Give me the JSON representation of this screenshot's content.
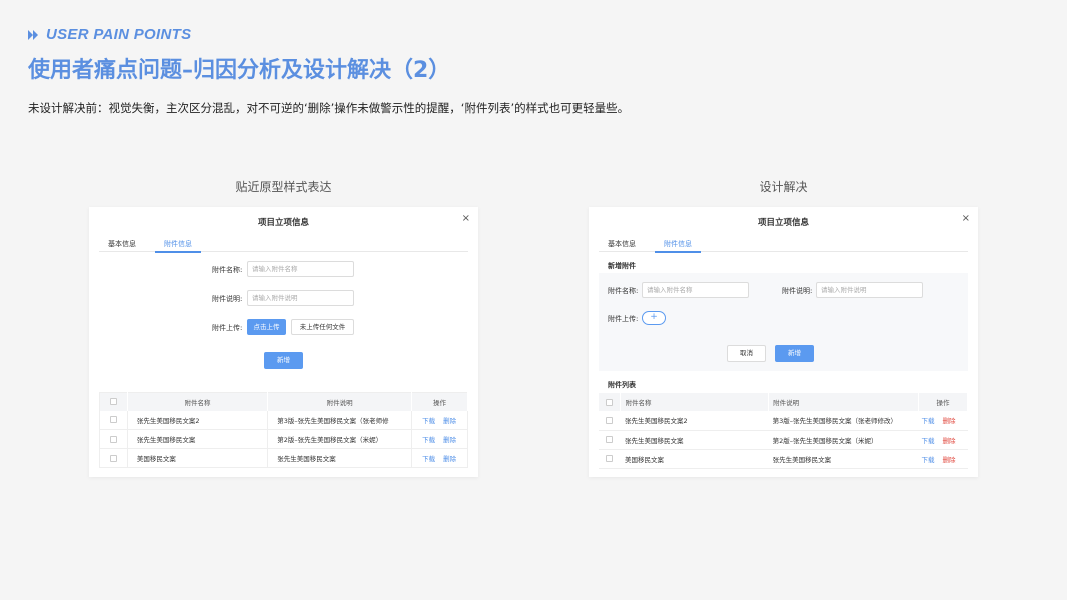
{
  "header": {
    "eyebrow": "USER PAIN POINTS",
    "title": "使用者痛点问题–归因分析及设计解决（2）",
    "description": "未设计解决前：视觉失衡，主次区分混乱，对不可逆的‘删除’操作未做警示性的提醒，‘附件列表’的样式也可更轻量些。"
  },
  "colors": {
    "accent": "#5b8fe0",
    "primary_button": "#5b9af0",
    "danger": "#e0463c"
  },
  "left_panel": {
    "caption": "贴近原型样式表达",
    "modal_title": "项目立项信息",
    "close_icon": "×",
    "tabs": [
      "基本信息",
      "附件信息"
    ],
    "name_label": "附件名称:",
    "name_placeholder": "请输入附件名称",
    "desc_label": "附件说明:",
    "desc_placeholder": "请输入附件说明",
    "upload_label": "附件上传:",
    "upload_button": "点击上传",
    "upload_status": "未上传任何文件",
    "add_button": "新增",
    "table": {
      "headers": [
        "附件名称",
        "附件说明",
        "操作"
      ],
      "rows": [
        {
          "name": "张先生美国移民文案2",
          "desc": "第3版–张先生美国移民文案（张老师修",
          "download": "下载",
          "delete": "删除"
        },
        {
          "name": "张先生美国移民文案",
          "desc": "第2版–张先生美国移民文案（米妮）",
          "download": "下载",
          "delete": "删除"
        },
        {
          "name": "美国移民文案",
          "desc": "张先生美国移民文案",
          "download": "下载",
          "delete": "删除"
        }
      ]
    }
  },
  "right_panel": {
    "caption": "设计解决",
    "modal_title": "项目立项信息",
    "close_icon": "×",
    "tabs": [
      "基本信息",
      "附件信息"
    ],
    "new_section": "新增附件",
    "name_label": "附件名称:",
    "name_placeholder": "请输入附件名称",
    "desc_label": "附件说明:",
    "desc_placeholder": "请输入附件说明",
    "upload_label": "附件上传:",
    "plus_icon": "+",
    "cancel_button": "取消",
    "add_button": "新增",
    "list_section": "附件列表",
    "table": {
      "headers": [
        "附件名称",
        "附件说明",
        "操作"
      ],
      "rows": [
        {
          "name": "张先生美国移民文案2",
          "desc": "第3版–张先生美国移民文案（张老师修改）",
          "download": "下载",
          "delete": "删除"
        },
        {
          "name": "张先生美国移民文案",
          "desc": "第2版–张先生美国移民文案（米妮）",
          "download": "下载",
          "delete": "删除"
        },
        {
          "name": "美国移民文案",
          "desc": "张先生美国移民文案",
          "download": "下载",
          "delete": "删除"
        }
      ]
    }
  }
}
